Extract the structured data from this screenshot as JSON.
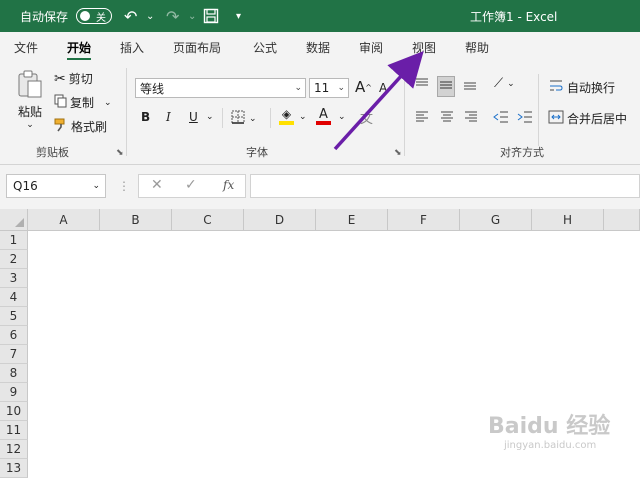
{
  "titlebar": {
    "autosave_label": "自动保存",
    "autosave_state": "关",
    "doc_title": "工作簿1  -  Excel",
    "undo_icon": "undo-icon",
    "redo_icon": "redo-icon",
    "save_icon": "save-icon"
  },
  "tabs": [
    "文件",
    "开始",
    "插入",
    "页面布局",
    "公式",
    "数据",
    "审阅",
    "视图",
    "帮助"
  ],
  "ribbon": {
    "clipboard": {
      "paste": "粘贴",
      "cut": "剪切",
      "copy": "复制",
      "format_painter": "格式刷",
      "group": "剪贴板"
    },
    "font": {
      "name": "等线",
      "size": "11",
      "group": "字体",
      "bold": "B",
      "italic": "I",
      "underline": "U",
      "grow": "A",
      "shrink": "A",
      "font_color_letter": "A",
      "font_color": "#e00000",
      "highlight_color": "#ffe000"
    },
    "alignment": {
      "wrap_text": "自动换行",
      "merge_center": "合并后居中",
      "group": "对齐方式"
    }
  },
  "formula": {
    "name_box": "Q16",
    "fx": "fx"
  },
  "grid": {
    "columns": [
      "A",
      "B",
      "C",
      "D",
      "E",
      "F",
      "G",
      "H"
    ],
    "rows": [
      "1",
      "2",
      "3",
      "4",
      "5",
      "6",
      "7",
      "8",
      "9",
      "10",
      "11",
      "12",
      "13"
    ]
  },
  "annotation_color": "#6a1ea8",
  "watermark": {
    "logo": "Baidu 经验",
    "url": "jingyan.baidu.com"
  },
  "accent": "#217346"
}
